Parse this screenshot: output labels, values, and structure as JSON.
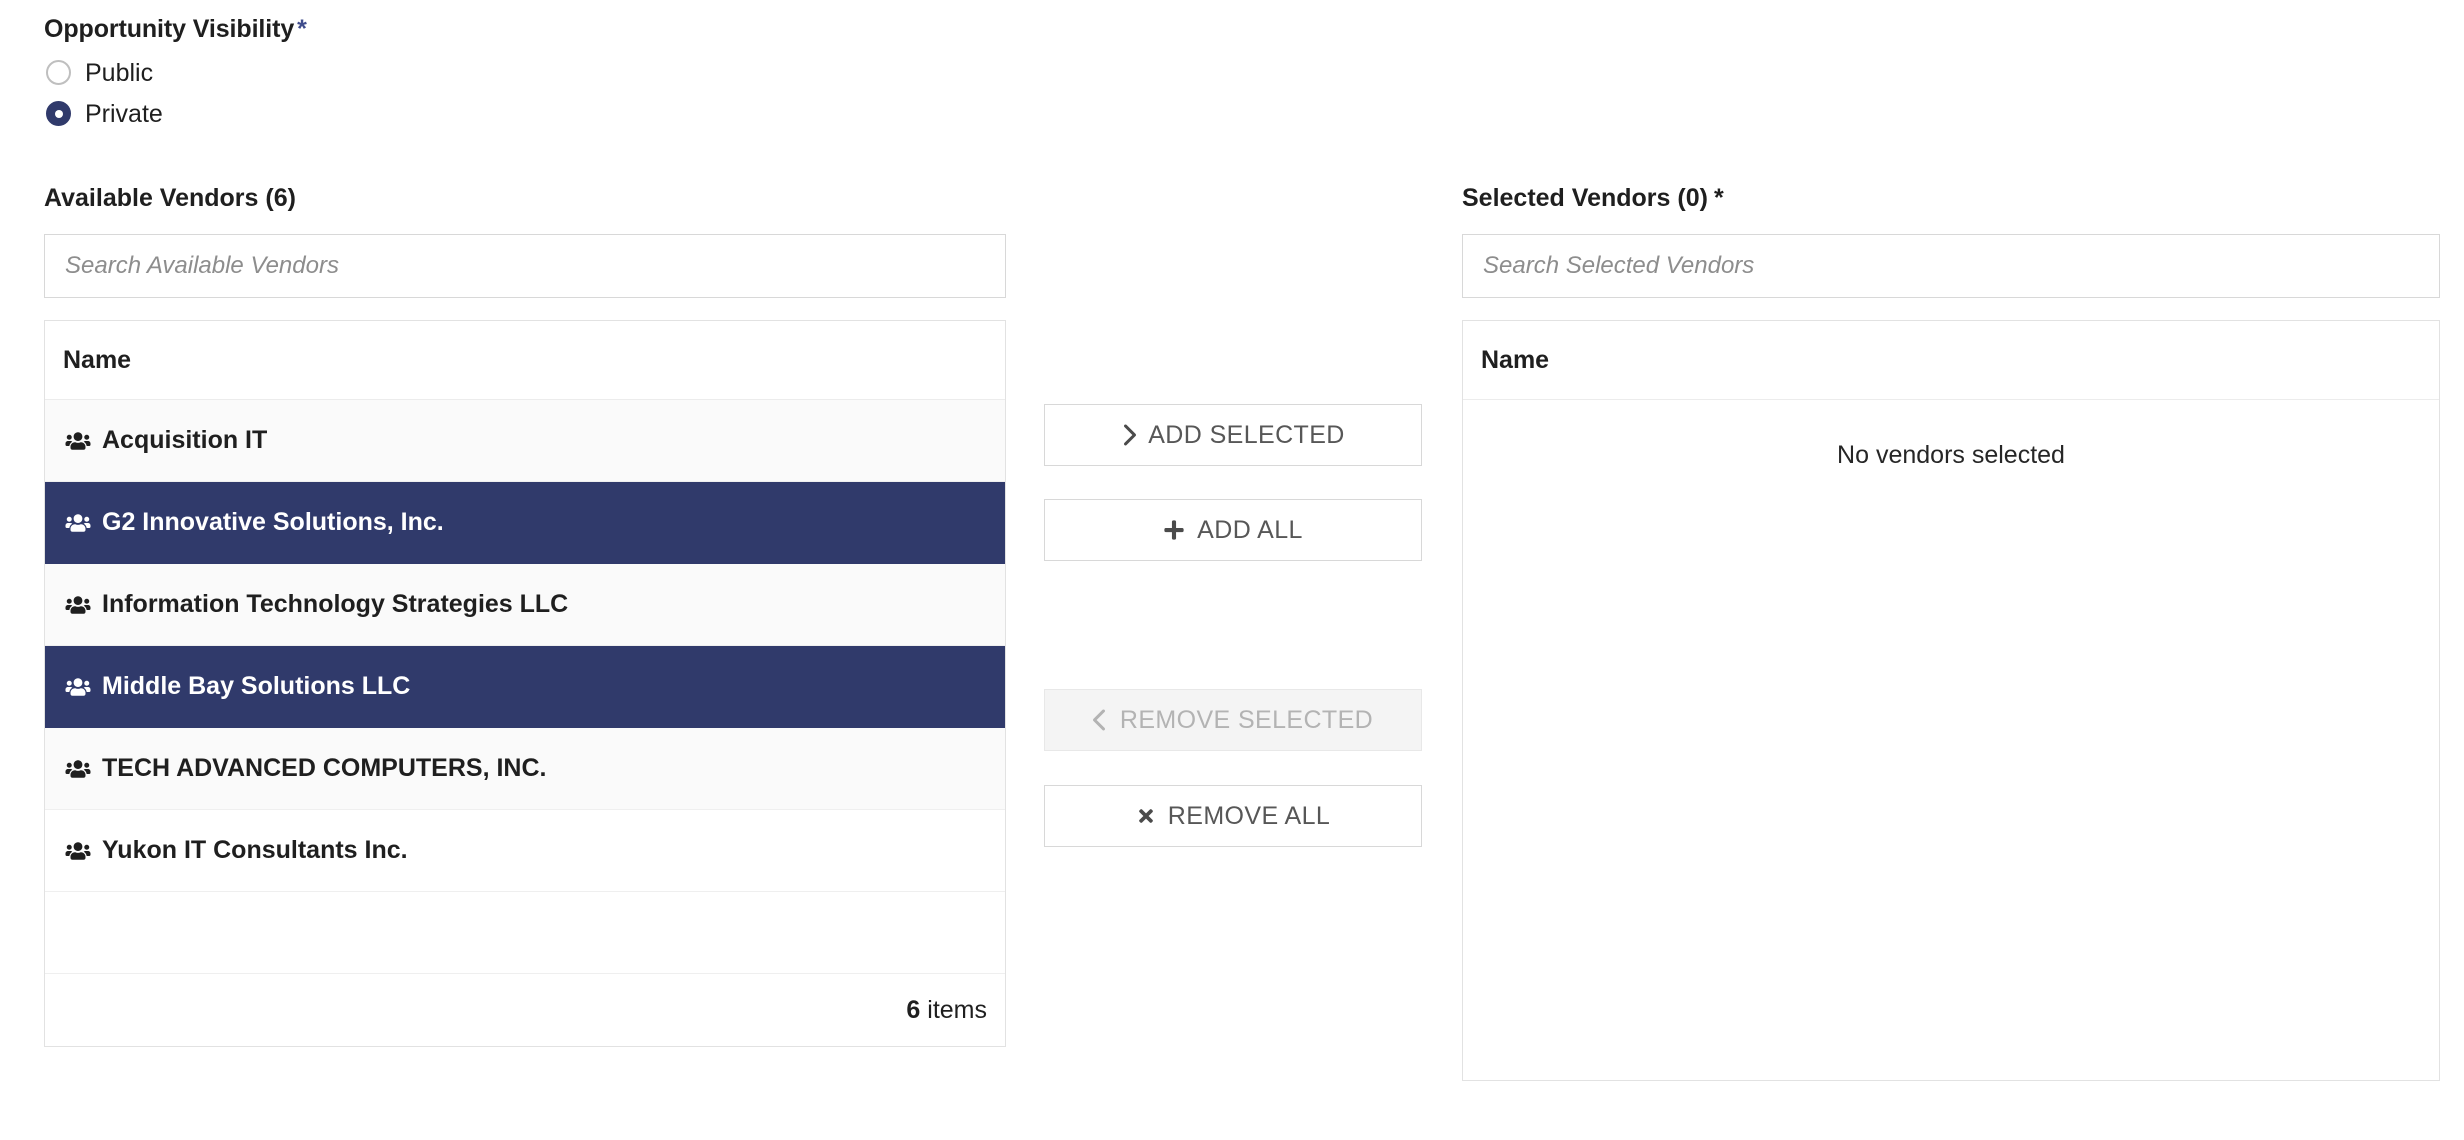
{
  "visibility": {
    "label": "Opportunity Visibility",
    "required_marker": "*",
    "options": [
      {
        "label": "Public",
        "selected": false
      },
      {
        "label": "Private",
        "selected": true
      }
    ]
  },
  "available_panel": {
    "title": "Available Vendors (6)",
    "search_placeholder": "Search Available Vendors",
    "search_value": "",
    "column_header": "Name",
    "rows": [
      {
        "name": "Acquisition IT",
        "selected": false
      },
      {
        "name": "G2 Innovative Solutions, Inc.",
        "selected": true
      },
      {
        "name": "Information Technology Strategies LLC",
        "selected": false
      },
      {
        "name": "Middle Bay Solutions LLC",
        "selected": true
      },
      {
        "name": "TECH ADVANCED COMPUTERS, INC.",
        "selected": false
      },
      {
        "name": "Yukon IT Consultants Inc.",
        "selected": false
      }
    ],
    "footer_count": "6",
    "footer_unit": "items"
  },
  "selected_panel": {
    "title": "Selected Vendors (0)",
    "required_marker": "*",
    "search_placeholder": "Search Selected Vendors",
    "search_value": "",
    "column_header": "Name",
    "empty_message": "No vendors selected"
  },
  "actions": {
    "add_selected": {
      "label": "ADD SELECTED",
      "icon": "chevron-right-icon",
      "disabled": false
    },
    "add_all": {
      "label": "ADD ALL",
      "icon": "plus-icon",
      "disabled": false
    },
    "remove_selected": {
      "label": "REMOVE SELECTED",
      "icon": "chevron-left-icon",
      "disabled": true
    },
    "remove_all": {
      "label": "REMOVE ALL",
      "icon": "times-icon",
      "disabled": false
    }
  },
  "colors": {
    "selected_row_bg": "#303a6b",
    "radio_accent": "#303a6b",
    "required_star": "#3f4c8c",
    "panel_border": "#e2e2e2",
    "row_alt_bg": "#fafafa",
    "disabled_text": "#b3b3b3"
  }
}
